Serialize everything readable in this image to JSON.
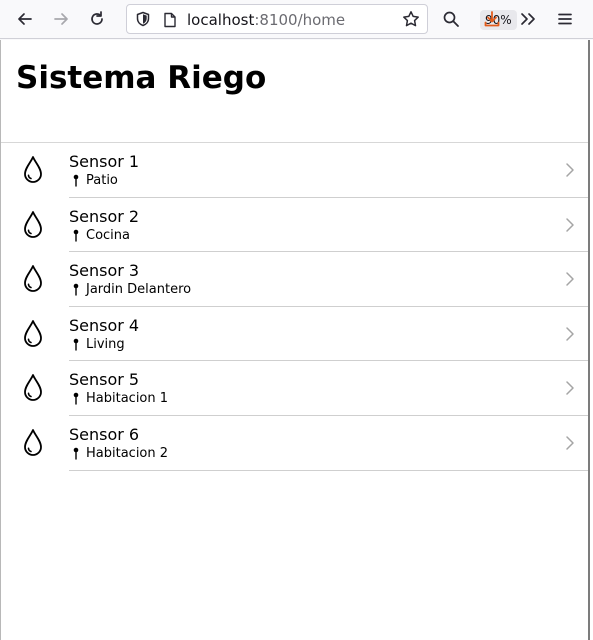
{
  "browser": {
    "url_host": "localhost",
    "url_rest": ":8100/home",
    "zoom": "90%"
  },
  "app": {
    "title": "Sistema Riego"
  },
  "sensors": [
    {
      "name": "Sensor 1",
      "location": "Patio"
    },
    {
      "name": "Sensor 2",
      "location": "Cocina"
    },
    {
      "name": "Sensor 3",
      "location": "Jardin Delantero"
    },
    {
      "name": "Sensor 4",
      "location": "Living"
    },
    {
      "name": "Sensor 5",
      "location": "Habitacion 1"
    },
    {
      "name": "Sensor 6",
      "location": "Habitacion 2"
    }
  ],
  "icons": {
    "back": "arrow-left-icon",
    "forward": "arrow-right-icon",
    "reload": "reload-icon",
    "tracking": "shield-icon",
    "page": "page-icon",
    "bookmark": "star-icon",
    "search": "search-icon",
    "download": "download-icon",
    "overflow": "double-chevron-icon",
    "menu": "hamburger-menu-icon",
    "sensor": "water-drop-icon",
    "location": "pin-icon",
    "row_nav": "chevron-right-icon"
  },
  "colors": {
    "download_accent": "#e35b1b"
  }
}
